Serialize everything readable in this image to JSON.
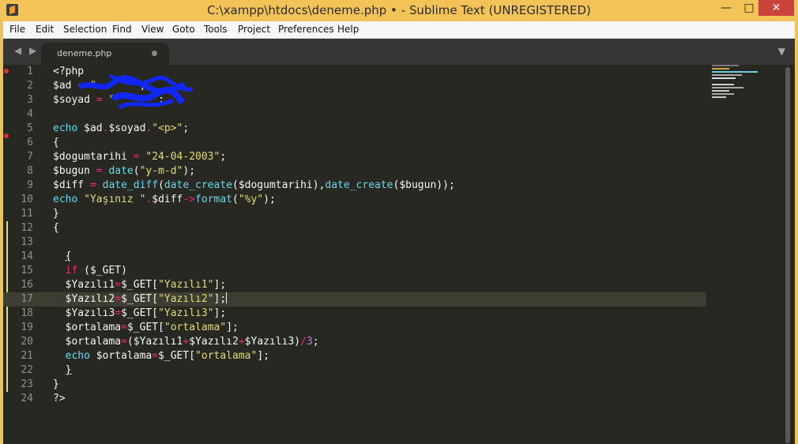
{
  "window": {
    "title": "C:\\xampp\\htdocs\\deneme.php • - Sublime Text (UNREGISTERED)",
    "minimize": "—",
    "maximize": "□",
    "close": "✕"
  },
  "menu": [
    "File",
    "Edit",
    "Selection",
    "Find",
    "View",
    "Goto",
    "Tools",
    "Project",
    "Preferences",
    "Help"
  ],
  "tabs": {
    "nav": "◀ ▶",
    "active": "deneme.php",
    "menu": "▼"
  },
  "code": {
    "line_numbers": [
      "1",
      "2",
      "3",
      "4",
      "5",
      "6",
      "7",
      "8",
      "9",
      "10",
      "11",
      "12",
      "13",
      "14",
      "15",
      "16",
      "17",
      "18",
      "19",
      "20",
      "21",
      "22",
      "23",
      "24"
    ],
    "current_line": "17"
  },
  "colors": {
    "background": "#272822",
    "tabbar": "#363636",
    "titlebar": "#f3c357",
    "keyword": "#66d9ef",
    "string": "#e6db74",
    "operator": "#f92672",
    "number": "#ae81ff"
  },
  "icons": {
    "app": "sublime-icon",
    "tab_close": "dirty-dot-icon",
    "tab_menu": "chevron-down-icon"
  }
}
